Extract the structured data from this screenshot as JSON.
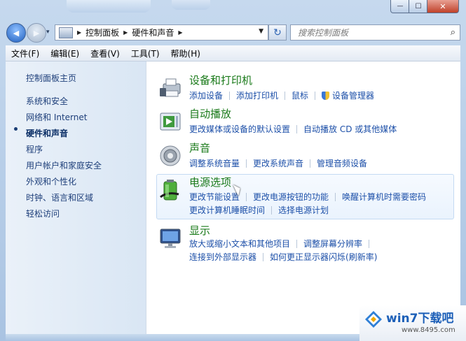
{
  "window": {
    "controls": {
      "minimize": "—",
      "maximize": "☐",
      "close": "✕"
    }
  },
  "address": {
    "crumbs": [
      "控制面板",
      "硬件和声音"
    ],
    "sep": "▶",
    "dropdown": "▼"
  },
  "nav": {
    "back": "◀",
    "forward": "▶",
    "history": "▾",
    "refresh": "↻"
  },
  "search": {
    "placeholder": "搜索控制面板",
    "icon": "⌕"
  },
  "menu": [
    "文件(F)",
    "编辑(E)",
    "查看(V)",
    "工具(T)",
    "帮助(H)"
  ],
  "sidebar": {
    "items": [
      "控制面板主页",
      "系统和安全",
      "网络和 Internet",
      "硬件和声音",
      "程序",
      "用户帐户和家庭安全",
      "外观和个性化",
      "时钟、语言和区域",
      "轻松访问"
    ],
    "active_index": 3
  },
  "categories": [
    {
      "title": "设备和打印机",
      "icon": "printer-icon",
      "rows": [
        [
          "添加设备",
          "添加打印机",
          "鼠标",
          "设备管理器"
        ]
      ]
    },
    {
      "title": "自动播放",
      "icon": "autoplay-icon",
      "rows": [
        [
          "更改媒体或设备的默认设置",
          "自动播放 CD 或其他媒体"
        ]
      ]
    },
    {
      "title": "声音",
      "icon": "speaker-icon",
      "rows": [
        [
          "调整系统音量",
          "更改系统声音",
          "管理音频设备"
        ]
      ]
    },
    {
      "title": "电源选项",
      "icon": "battery-icon",
      "rows": [
        [
          "更改节能设置",
          "更改电源按钮的功能",
          "唤醒计算机时需要密码"
        ],
        [
          "更改计算机睡眠时间",
          "选择电源计划"
        ]
      ]
    },
    {
      "title": "显示",
      "icon": "monitor-icon",
      "rows": [
        [
          "放大或缩小文本和其他项目",
          "调整屏幕分辨率"
        ],
        [
          "连接到外部显示器",
          "如何更正显示器闪烁(刷新率)"
        ]
      ]
    }
  ],
  "watermark": {
    "text": "win7下载吧",
    "url": "www.8495.com"
  }
}
